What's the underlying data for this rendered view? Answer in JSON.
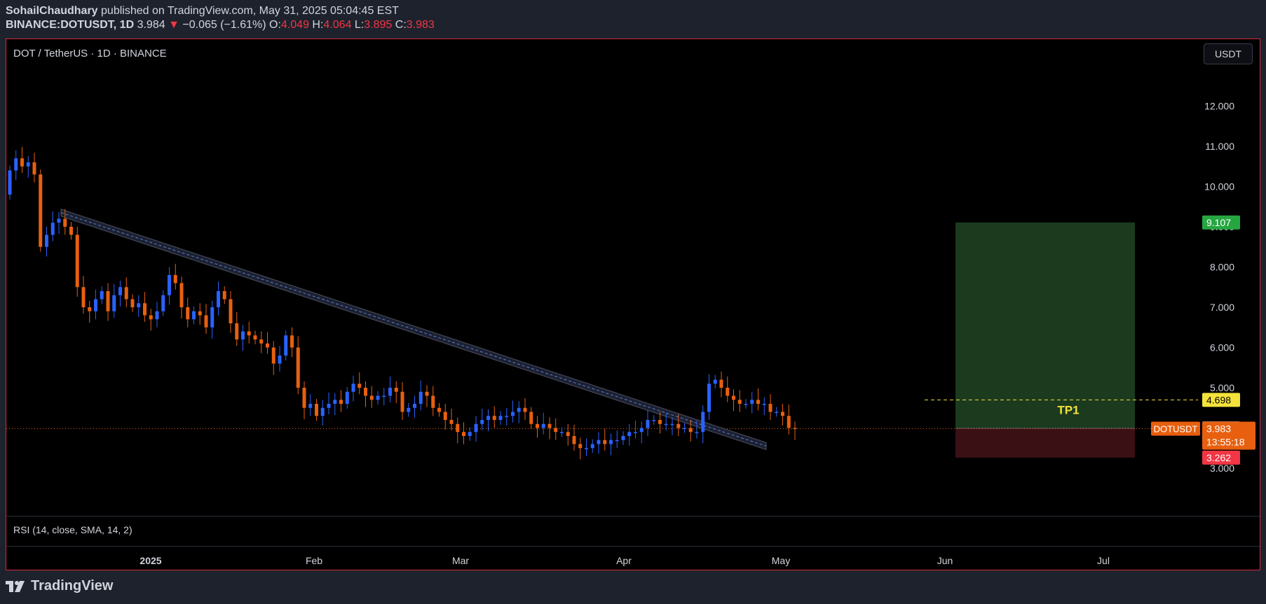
{
  "header": {
    "author": "SohailChaudhary",
    "published": "published on TradingView.com, May 31, 2025 05:04:45 EST",
    "symbol": "BINANCE:DOTUSDT, 1D",
    "last": "3.984",
    "change": "−0.065 (−1.61%)",
    "o_label": "O:",
    "o": "4.049",
    "h_label": "H:",
    "h": "4.064",
    "l_label": "L:",
    "l": "3.895",
    "c_label": "C:",
    "c": "3.983"
  },
  "chart": {
    "title": "DOT / TetherUS · 1D · BINANCE",
    "currency_button": "USDT",
    "rsi_label": "RSI (14, close, SMA, 14, 2)",
    "tp_label": "TP1",
    "symbol_tag": "DOTUSDT",
    "countdown": "13:55:18"
  },
  "footer": {
    "brand": "TradingView"
  },
  "colors": {
    "up": "#2962ff",
    "down": "#e8600f",
    "target": "#1b3a1e",
    "stop": "#3a1014",
    "tp_line": "#f5e23a",
    "price_tag": "#e8600f"
  },
  "chart_data": {
    "type": "candlestick",
    "title": "DOT / TetherUS · 1D · BINANCE",
    "ylim": [
      2.5,
      12.4
    ],
    "y_ticks": [
      "12.000",
      "11.000",
      "10.000",
      "9.000",
      "8.000",
      "7.000",
      "6.000",
      "5.000",
      "4.000",
      "3.000"
    ],
    "x_ticks": [
      "2025",
      "Feb",
      "Mar",
      "Apr",
      "May",
      "Jun",
      "Jul"
    ],
    "closes": [
      10.4,
      10.7,
      10.5,
      10.6,
      10.3,
      8.5,
      8.8,
      9.1,
      9.2,
      9.0,
      8.8,
      7.5,
      7.0,
      6.9,
      7.2,
      7.4,
      6.9,
      7.3,
      7.5,
      7.2,
      7.0,
      7.1,
      6.8,
      6.7,
      6.9,
      7.3,
      7.8,
      7.6,
      7.0,
      6.7,
      6.9,
      6.8,
      6.5,
      7.0,
      7.4,
      7.2,
      6.6,
      6.2,
      6.4,
      6.3,
      6.2,
      6.1,
      6.0,
      5.6,
      5.8,
      6.3,
      6.0,
      5.0,
      4.5,
      4.6,
      4.3,
      4.5,
      4.6,
      4.7,
      4.6,
      4.9,
      5.1,
      5.0,
      4.8,
      4.7,
      4.8,
      4.8,
      5.0,
      4.9,
      4.4,
      4.5,
      4.6,
      4.9,
      4.8,
      4.5,
      4.4,
      4.2,
      4.1,
      3.9,
      3.8,
      3.9,
      4.1,
      4.2,
      4.3,
      4.2,
      4.3,
      4.3,
      4.4,
      4.5,
      4.4,
      4.1,
      4.0,
      4.1,
      4.0,
      3.9,
      3.9,
      3.8,
      3.6,
      3.5,
      3.5,
      3.6,
      3.7,
      3.6,
      3.7,
      3.7,
      3.8,
      3.9,
      3.9,
      4.0,
      4.2,
      4.2,
      4.1,
      4.1,
      4.1,
      4.0,
      4.0,
      3.9,
      3.9,
      4.4,
      5.1,
      5.2,
      5.0,
      4.8,
      4.7,
      4.6,
      4.6,
      4.7,
      4.6,
      4.6,
      4.4,
      4.4,
      4.3,
      4.0,
      3.983
    ],
    "trendline": {
      "start": [
        "2024-12-19",
        9.35
      ],
      "end": [
        "2025-04-27",
        3.55
      ]
    },
    "position": {
      "target": "9.107",
      "entry": "3.993",
      "stop": "3.262",
      "tp1": "4.698",
      "current": "3.983"
    }
  }
}
